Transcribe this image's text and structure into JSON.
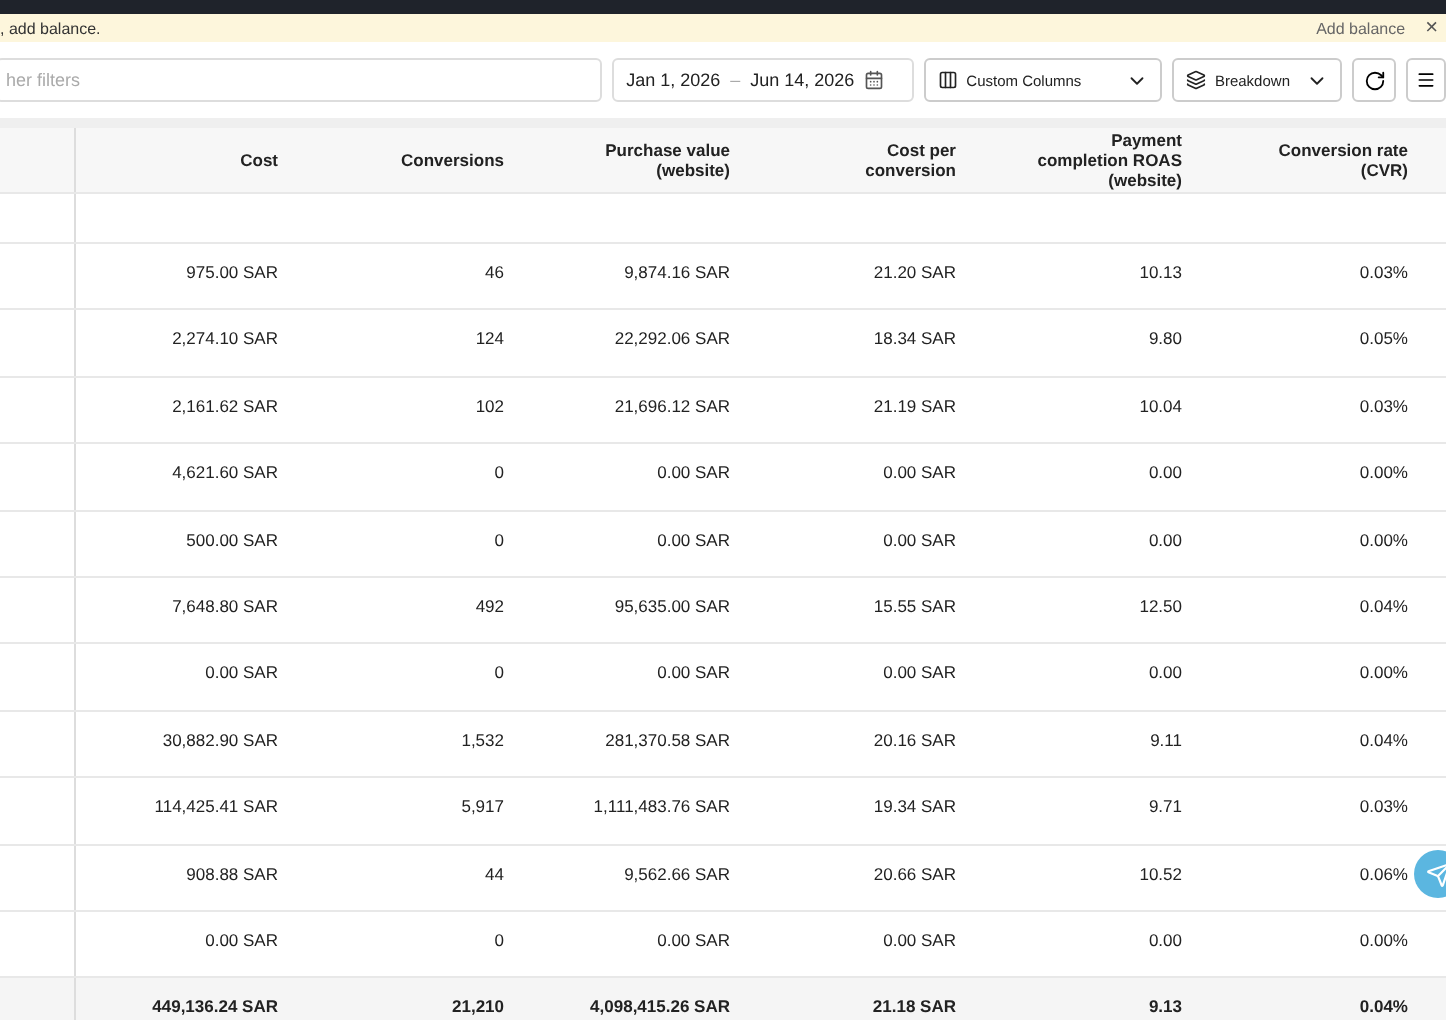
{
  "banner": {
    "message": ", add balance.",
    "action": "Add balance",
    "close": "×"
  },
  "toolbar": {
    "search": {
      "placeholder": "her filters"
    },
    "date_range": {
      "start": "Jan 1, 2026",
      "separator": "–",
      "end": "Jun 14, 2026"
    },
    "buttons": [
      {
        "label": "Custom Columns",
        "kind": "columns"
      },
      {
        "label": "Breakdown",
        "kind": "breakdown"
      }
    ]
  },
  "table": {
    "columns": [
      "Cost",
      "Conversions",
      "Purchase value (website)",
      "Cost per conversion",
      "Payment completion ROAS (website)",
      "Conversion rate (CVR)"
    ],
    "rows": [
      [
        "975.00 SAR",
        "46",
        "9,874.16 SAR",
        "21.20 SAR",
        "10.13",
        "0.03%"
      ],
      [
        "2,274.10 SAR",
        "124",
        "22,292.06 SAR",
        "18.34 SAR",
        "9.80",
        "0.05%"
      ],
      [
        "2,161.62 SAR",
        "102",
        "21,696.12 SAR",
        "21.19 SAR",
        "10.04",
        "0.03%"
      ],
      [
        "4,621.60 SAR",
        "0",
        "0.00 SAR",
        "0.00 SAR",
        "0.00",
        "0.00%"
      ],
      [
        "500.00 SAR",
        "0",
        "0.00 SAR",
        "0.00 SAR",
        "0.00",
        "0.00%"
      ],
      [
        "7,648.80 SAR",
        "492",
        "95,635.00 SAR",
        "15.55 SAR",
        "12.50",
        "0.04%"
      ],
      [
        "0.00 SAR",
        "0",
        "0.00 SAR",
        "0.00 SAR",
        "0.00",
        "0.00%"
      ],
      [
        "30,882.90 SAR",
        "1,532",
        "281,370.58 SAR",
        "20.16 SAR",
        "9.11",
        "0.04%"
      ],
      [
        "114,425.41 SAR",
        "5,917",
        "1,111,483.76 SAR",
        "19.34 SAR",
        "9.71",
        "0.03%"
      ],
      [
        "908.88 SAR",
        "44",
        "9,562.66 SAR",
        "20.66 SAR",
        "10.52",
        "0.06%"
      ],
      [
        "0.00 SAR",
        "0",
        "0.00 SAR",
        "0.00 SAR",
        "0.00",
        "0.00%"
      ]
    ],
    "totals": [
      "449,136.24 SAR",
      "21,210",
      "4,098,415.26 SAR",
      "21.18 SAR",
      "9.13",
      "0.04%"
    ]
  }
}
